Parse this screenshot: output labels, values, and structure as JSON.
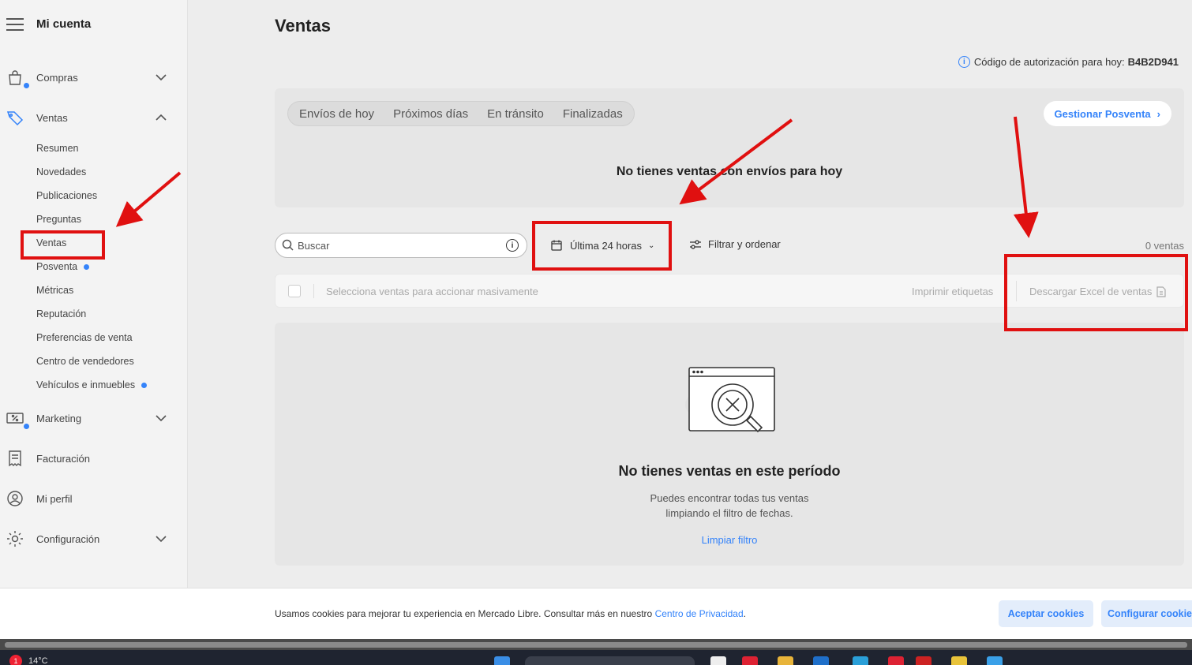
{
  "sidebar": {
    "title": "Mi cuenta",
    "sections": {
      "compras": "Compras",
      "ventas": "Ventas",
      "marketing": "Marketing",
      "facturacion": "Facturación",
      "perfil": "Mi perfil",
      "configuracion": "Configuración"
    },
    "ventas_items": [
      {
        "label": "Resumen"
      },
      {
        "label": "Novedades"
      },
      {
        "label": "Publicaciones"
      },
      {
        "label": "Preguntas"
      },
      {
        "label": "Ventas",
        "selected": true
      },
      {
        "label": "Posventa",
        "dot": true
      },
      {
        "label": "Métricas"
      },
      {
        "label": "Reputación"
      },
      {
        "label": "Preferencias de venta"
      },
      {
        "label": "Centro de vendedores"
      },
      {
        "label": "Vehículos e inmuebles",
        "dot": true
      }
    ]
  },
  "main": {
    "title": "Ventas",
    "auth_label": "Código de autorización para hoy:",
    "auth_code": "B4B2D941",
    "tabs": [
      {
        "label": "Envíos de hoy"
      },
      {
        "label": "Próximos días"
      },
      {
        "label": "En tránsito"
      },
      {
        "label": "Finalizadas"
      }
    ],
    "posventa_button": "Gestionar Posventa",
    "ship_empty": "No tienes ventas con envíos para hoy",
    "search_placeholder": "Buscar",
    "date_filter": "Última 24 horas",
    "filter_button": "Filtrar y ordenar",
    "count": "0 ventas",
    "bulk_text": "Selecciona ventas para accionar masivamente",
    "print_labels": "Imprimir etiquetas",
    "download_excel": "Descargar Excel de ventas",
    "empty_title": "No tienes ventas en este período",
    "empty_desc_1": "Puedes encontrar todas tus ventas",
    "empty_desc_2": "limpiando el filtro de fechas.",
    "clear_filter": "Limpiar filtro"
  },
  "cookie": {
    "text": "Usamos cookies para mejorar tu experiencia en Mercado Libre. Consultar más en nuestro",
    "link": "Centro de Privacidad",
    "accept": "Aceptar cookies",
    "configure": "Configurar cookies"
  },
  "taskbar": {
    "temperature": "14°C",
    "notification_count": "1"
  },
  "colors": {
    "accent": "#3483fa",
    "annotation": "#e01010"
  }
}
